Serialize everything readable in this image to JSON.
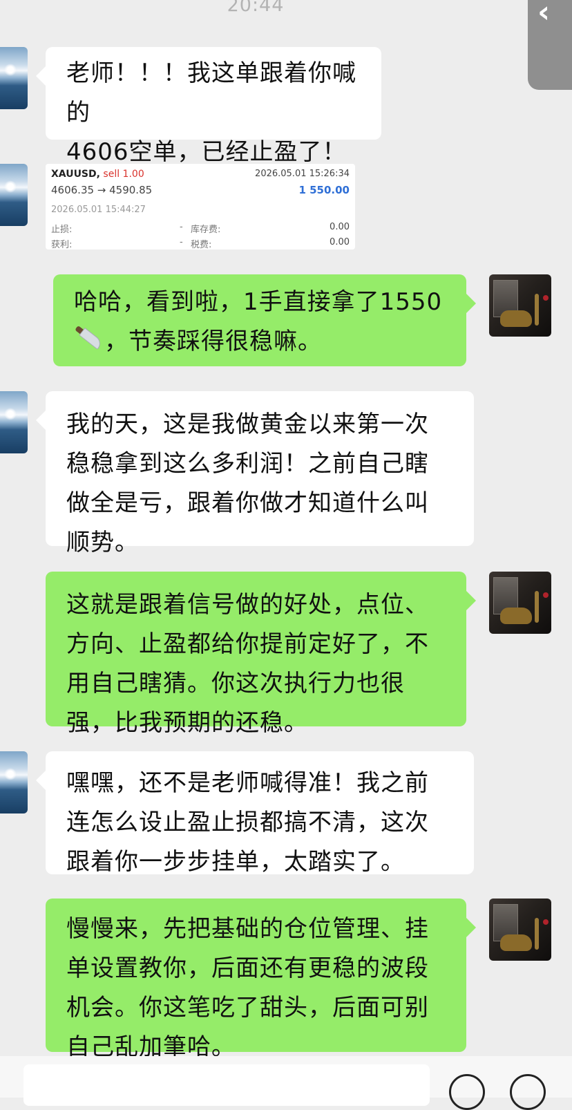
{
  "status_bar": {
    "time": "20:44"
  },
  "nav": {
    "back_icon": "chevron-left-icon"
  },
  "messages": [
    {
      "side": "left",
      "lines": [
        "老师！！！我这单跟着你喊的",
        "4606空单，已经止盈了！"
      ]
    },
    {
      "side": "left",
      "type": "trade-screenshot"
    },
    {
      "side": "right",
      "lines": [
        "哈哈，看到啦，1手直接拿了1550",
        "，节奏踩得很稳嘛。"
      ],
      "emoji": "knife-icon"
    },
    {
      "side": "left",
      "lines": [
        "我的天，这是我做黄金以来第一次",
        "稳稳拿到这么多利润！之前自己瞎",
        "做全是亏，跟着你做才知道什么叫",
        "顺势。"
      ]
    },
    {
      "side": "right",
      "lines": [
        "这就是跟着信号做的好处，点位、",
        "方向、止盈都给你提前定好了，不",
        "用自己瞎猜。你这次执行力也很",
        "强，比我预期的还稳。"
      ]
    },
    {
      "side": "left",
      "lines": [
        "嘿嘿，还不是老师喊得准！我之前",
        "连怎么设止盈止损都搞不清，这次",
        "跟着你一步步挂单，太踏实了。"
      ]
    },
    {
      "side": "right",
      "lines": [
        "慢慢来，先把基础的仓位管理、挂",
        "单设置教你，后面还有更稳的波段",
        "机会。你这笔吃了甜头，后面可别",
        "自己乱加筆哈。"
      ]
    }
  ],
  "trade": {
    "symbol": "XAUUSD,",
    "side": "sell 1.00",
    "open_time": "2026.05.01 15:26:34",
    "price_range": "4606.35 → 4590.85",
    "profit": "1 550.00",
    "close_time": "2026.05.01 15:44:27",
    "stop_loss_label": "止损:",
    "stop_loss_value": "-",
    "swap_label": "库存费:",
    "swap_value": "0.00",
    "take_profit_label": "获利:",
    "take_profit_value": "-",
    "tax_label": "税费:",
    "tax_value": "0.00"
  },
  "colors": {
    "background": "#ededed",
    "bubble_left": "#ffffff",
    "bubble_right": "#95ec69",
    "sell": "#d9322c",
    "profit": "#2f6fd6"
  }
}
